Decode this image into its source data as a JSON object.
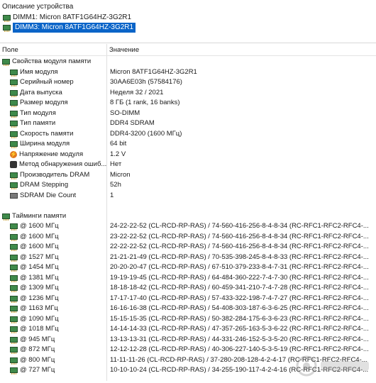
{
  "device_panel": {
    "header": "Описание устройства",
    "items": [
      {
        "label": "DIMM1: Micron 8ATF1G64HZ-3G2R1"
      },
      {
        "label": "DIMM3: Micron 8ATF1G64HZ-3G2R1"
      }
    ]
  },
  "columns": {
    "field": "Поле",
    "value": "Значение"
  },
  "memory_module_section": {
    "title": "Свойства модуля памяти",
    "rows": [
      {
        "field": "Имя модуля",
        "value": "Micron 8ATF1G64HZ-3G2R1",
        "icon": "ram-icon"
      },
      {
        "field": "Серийный номер",
        "value": "30AA6E03h (57584176)",
        "icon": "ram-icon"
      },
      {
        "field": "Дата выпуска",
        "value": "Неделя 32 / 2021",
        "icon": "ram-icon"
      },
      {
        "field": "Размер модуля",
        "value": "8 ГБ (1 rank, 16 banks)",
        "icon": "ram-icon"
      },
      {
        "field": "Тип модуля",
        "value": "SO-DIMM",
        "icon": "ram-icon"
      },
      {
        "field": "Тип памяти",
        "value": "DDR4 SDRAM",
        "icon": "ram-icon"
      },
      {
        "field": "Скорость памяти",
        "value": "DDR4-3200 (1600 МГц)",
        "icon": "ram-icon"
      },
      {
        "field": "Ширина модуля",
        "value": "64 bit",
        "icon": "ram-icon"
      },
      {
        "field": "Напряжение модуля",
        "value": "1.2 V",
        "icon": "bolt-icon"
      },
      {
        "field": "Метод обнаружения ошиб...",
        "value": "Нет",
        "icon": "gear-icon"
      },
      {
        "field": "Производитель DRAM",
        "value": "Micron",
        "icon": "ram-icon"
      },
      {
        "field": "DRAM Stepping",
        "value": "52h",
        "icon": "ram-icon"
      },
      {
        "field": "SDRAM Die Count",
        "value": "1",
        "icon": "chip-icon"
      }
    ]
  },
  "timings_section": {
    "title": "Тайминги памяти",
    "rows": [
      {
        "field": "@ 1600 МГц",
        "value": "24-22-22-52  (CL-RCD-RP-RAS) / 74-560-416-256-8-4-8-34  (RC-RFC1-RFC2-RFC4-..."
      },
      {
        "field": "@ 1600 МГц",
        "value": "23-22-22-52  (CL-RCD-RP-RAS) / 74-560-416-256-8-4-8-34  (RC-RFC1-RFC2-RFC4-..."
      },
      {
        "field": "@ 1600 МГц",
        "value": "22-22-22-52  (CL-RCD-RP-RAS) / 74-560-416-256-8-4-8-34  (RC-RFC1-RFC2-RFC4-..."
      },
      {
        "field": "@ 1527 МГц",
        "value": "21-21-21-49  (CL-RCD-RP-RAS) / 70-535-398-245-8-4-8-33  (RC-RFC1-RFC2-RFC4-..."
      },
      {
        "field": "@ 1454 МГц",
        "value": "20-20-20-47  (CL-RCD-RP-RAS) / 67-510-379-233-8-4-7-31  (RC-RFC1-RFC2-RFC4-..."
      },
      {
        "field": "@ 1381 МГц",
        "value": "19-19-19-45  (CL-RCD-RP-RAS) / 64-484-360-222-7-4-7-30  (RC-RFC1-RFC2-RFC4-..."
      },
      {
        "field": "@ 1309 МГц",
        "value": "18-18-18-42  (CL-RCD-RP-RAS) / 60-459-341-210-7-4-7-28  (RC-RFC1-RFC2-RFC4-..."
      },
      {
        "field": "@ 1236 МГц",
        "value": "17-17-17-40  (CL-RCD-RP-RAS) / 57-433-322-198-7-4-7-27  (RC-RFC1-RFC2-RFC4-..."
      },
      {
        "field": "@ 1163 МГц",
        "value": "16-16-16-38  (CL-RCD-RP-RAS) / 54-408-303-187-6-3-6-25  (RC-RFC1-RFC2-RFC4-..."
      },
      {
        "field": "@ 1090 МГц",
        "value": "15-15-15-35  (CL-RCD-RP-RAS) / 50-382-284-175-6-3-6-23  (RC-RFC1-RFC2-RFC4-..."
      },
      {
        "field": "@ 1018 МГц",
        "value": "14-14-14-33  (CL-RCD-RP-RAS) / 47-357-265-163-5-3-6-22  (RC-RFC1-RFC2-RFC4-..."
      },
      {
        "field": "@ 945 МГц",
        "value": "13-13-13-31  (CL-RCD-RP-RAS) / 44-331-246-152-5-3-5-20  (RC-RFC1-RFC2-RFC4-..."
      },
      {
        "field": "@ 872 МГц",
        "value": "12-12-12-28  (CL-RCD-RP-RAS) / 40-306-227-140-5-3-5-19  (RC-RFC1-RFC2-RFC4-..."
      },
      {
        "field": "@ 800 МГц",
        "value": "11-11-11-26  (CL-RCD-RP-RAS) / 37-280-208-128-4-2-4-17  (RC-RFC1-RFC2-RFC4-..."
      },
      {
        "field": "@ 727 МГц",
        "value": "10-10-10-24  (CL-RCD-RP-RAS) / 34-255-190-117-4-2-4-16  (RC-RFC1-RFC2-RFC4-..."
      }
    ]
  },
  "colors": {
    "selection": "#0a64c8",
    "ram_green": "#3f8a4a"
  }
}
